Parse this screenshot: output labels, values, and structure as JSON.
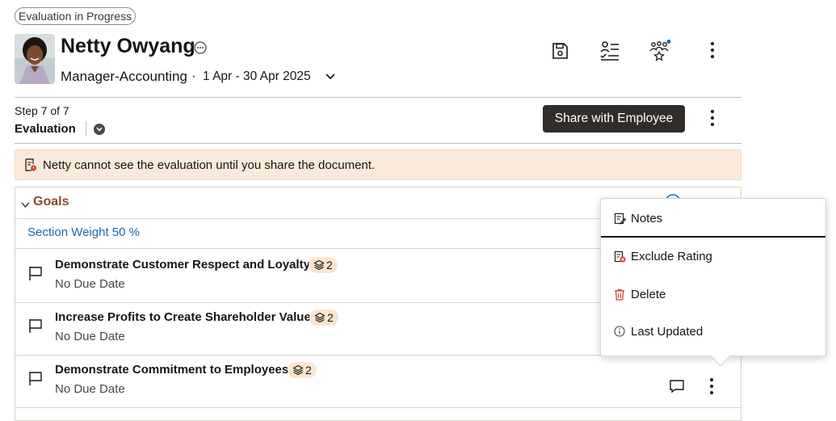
{
  "header": {
    "status": "Evaluation in Progress",
    "employee_name": "Netty Owyang",
    "job_title": "Manager-Accounting",
    "separator": "·",
    "period": "1 Apr - 30 Apr 2025"
  },
  "step": {
    "label": "Step 7 of 7",
    "name": "Evaluation",
    "share_button": "Share with Employee"
  },
  "banner": {
    "message": "Netty cannot see the evaluation until you share the document."
  },
  "goals": {
    "section_title": "Goals",
    "section_weight": "Section Weight 50 %",
    "items": [
      {
        "title": "Demonstrate Customer Respect and Loyalty",
        "badge": "2",
        "due": "No Due Date"
      },
      {
        "title": "Increase Profits to Create Shareholder Value",
        "badge": "2",
        "due": "No Due Date"
      },
      {
        "title": "Demonstrate Commitment to Employees",
        "badge": "2",
        "due": "No Due Date"
      }
    ]
  },
  "menu": {
    "items": [
      {
        "label": "Notes",
        "icon": "notes-icon"
      },
      {
        "label": "Exclude Rating",
        "icon": "exclude-rating-icon"
      },
      {
        "label": "Delete",
        "icon": "trash-icon"
      },
      {
        "label": "Last Updated",
        "icon": "info-icon"
      }
    ]
  },
  "colors": {
    "accent_dark": "#312d2a",
    "goals_title": "#8a4b2b",
    "link_blue": "#1c6aa5",
    "banner_bg": "#fbeadb",
    "badge_bg": "#fbe5cf",
    "delete_red": "#c74634"
  }
}
